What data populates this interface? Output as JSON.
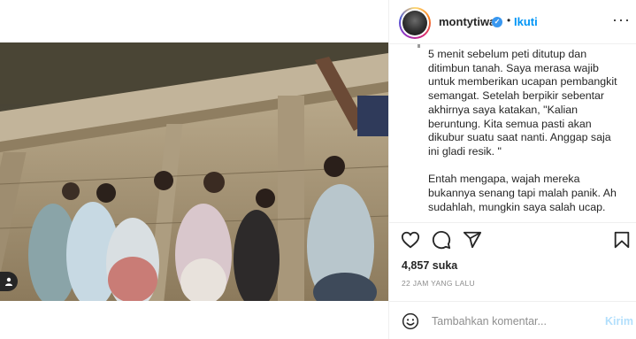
{
  "post": {
    "username": "montytiwa",
    "verified_badge": "verified-icon",
    "separator": "•",
    "follow_label": "Ikuti",
    "more_label": "···"
  },
  "caption": {
    "paragraphs": [
      "5 menit sebelum peti ditutup dan ditimbun tanah. Saya merasa wajib untuk memberikan ucapan pembangkit semangat. Setelah berpikir sebentar akhirnya saya katakan, \"Kalian beruntung. Kita semua pasti akan dikubur suatu saat nanti. Anggap saja ini gladi resik. \"",
      "Entah mengapa, wajah mereka bukannya senang tapi malah panik. Ah sudahlah, mungkin saya salah ucap. Tapi sungguh..."
    ]
  },
  "stats": {
    "likes": "4,857 suka",
    "time_ago": "22 JAM YANG LALU"
  },
  "comment": {
    "placeholder": "Tambahkan komentar...",
    "post_label": "Kirim"
  },
  "icons": {
    "like": "heart-icon",
    "comment": "comment-icon",
    "share": "share-icon",
    "save": "bookmark-icon",
    "emoji": "emoji-icon",
    "user_tag": "user-tag-icon"
  },
  "colors": {
    "accent": "#0095f6",
    "post_disabled": "#b2dffc",
    "muted": "#8e8e8e"
  }
}
